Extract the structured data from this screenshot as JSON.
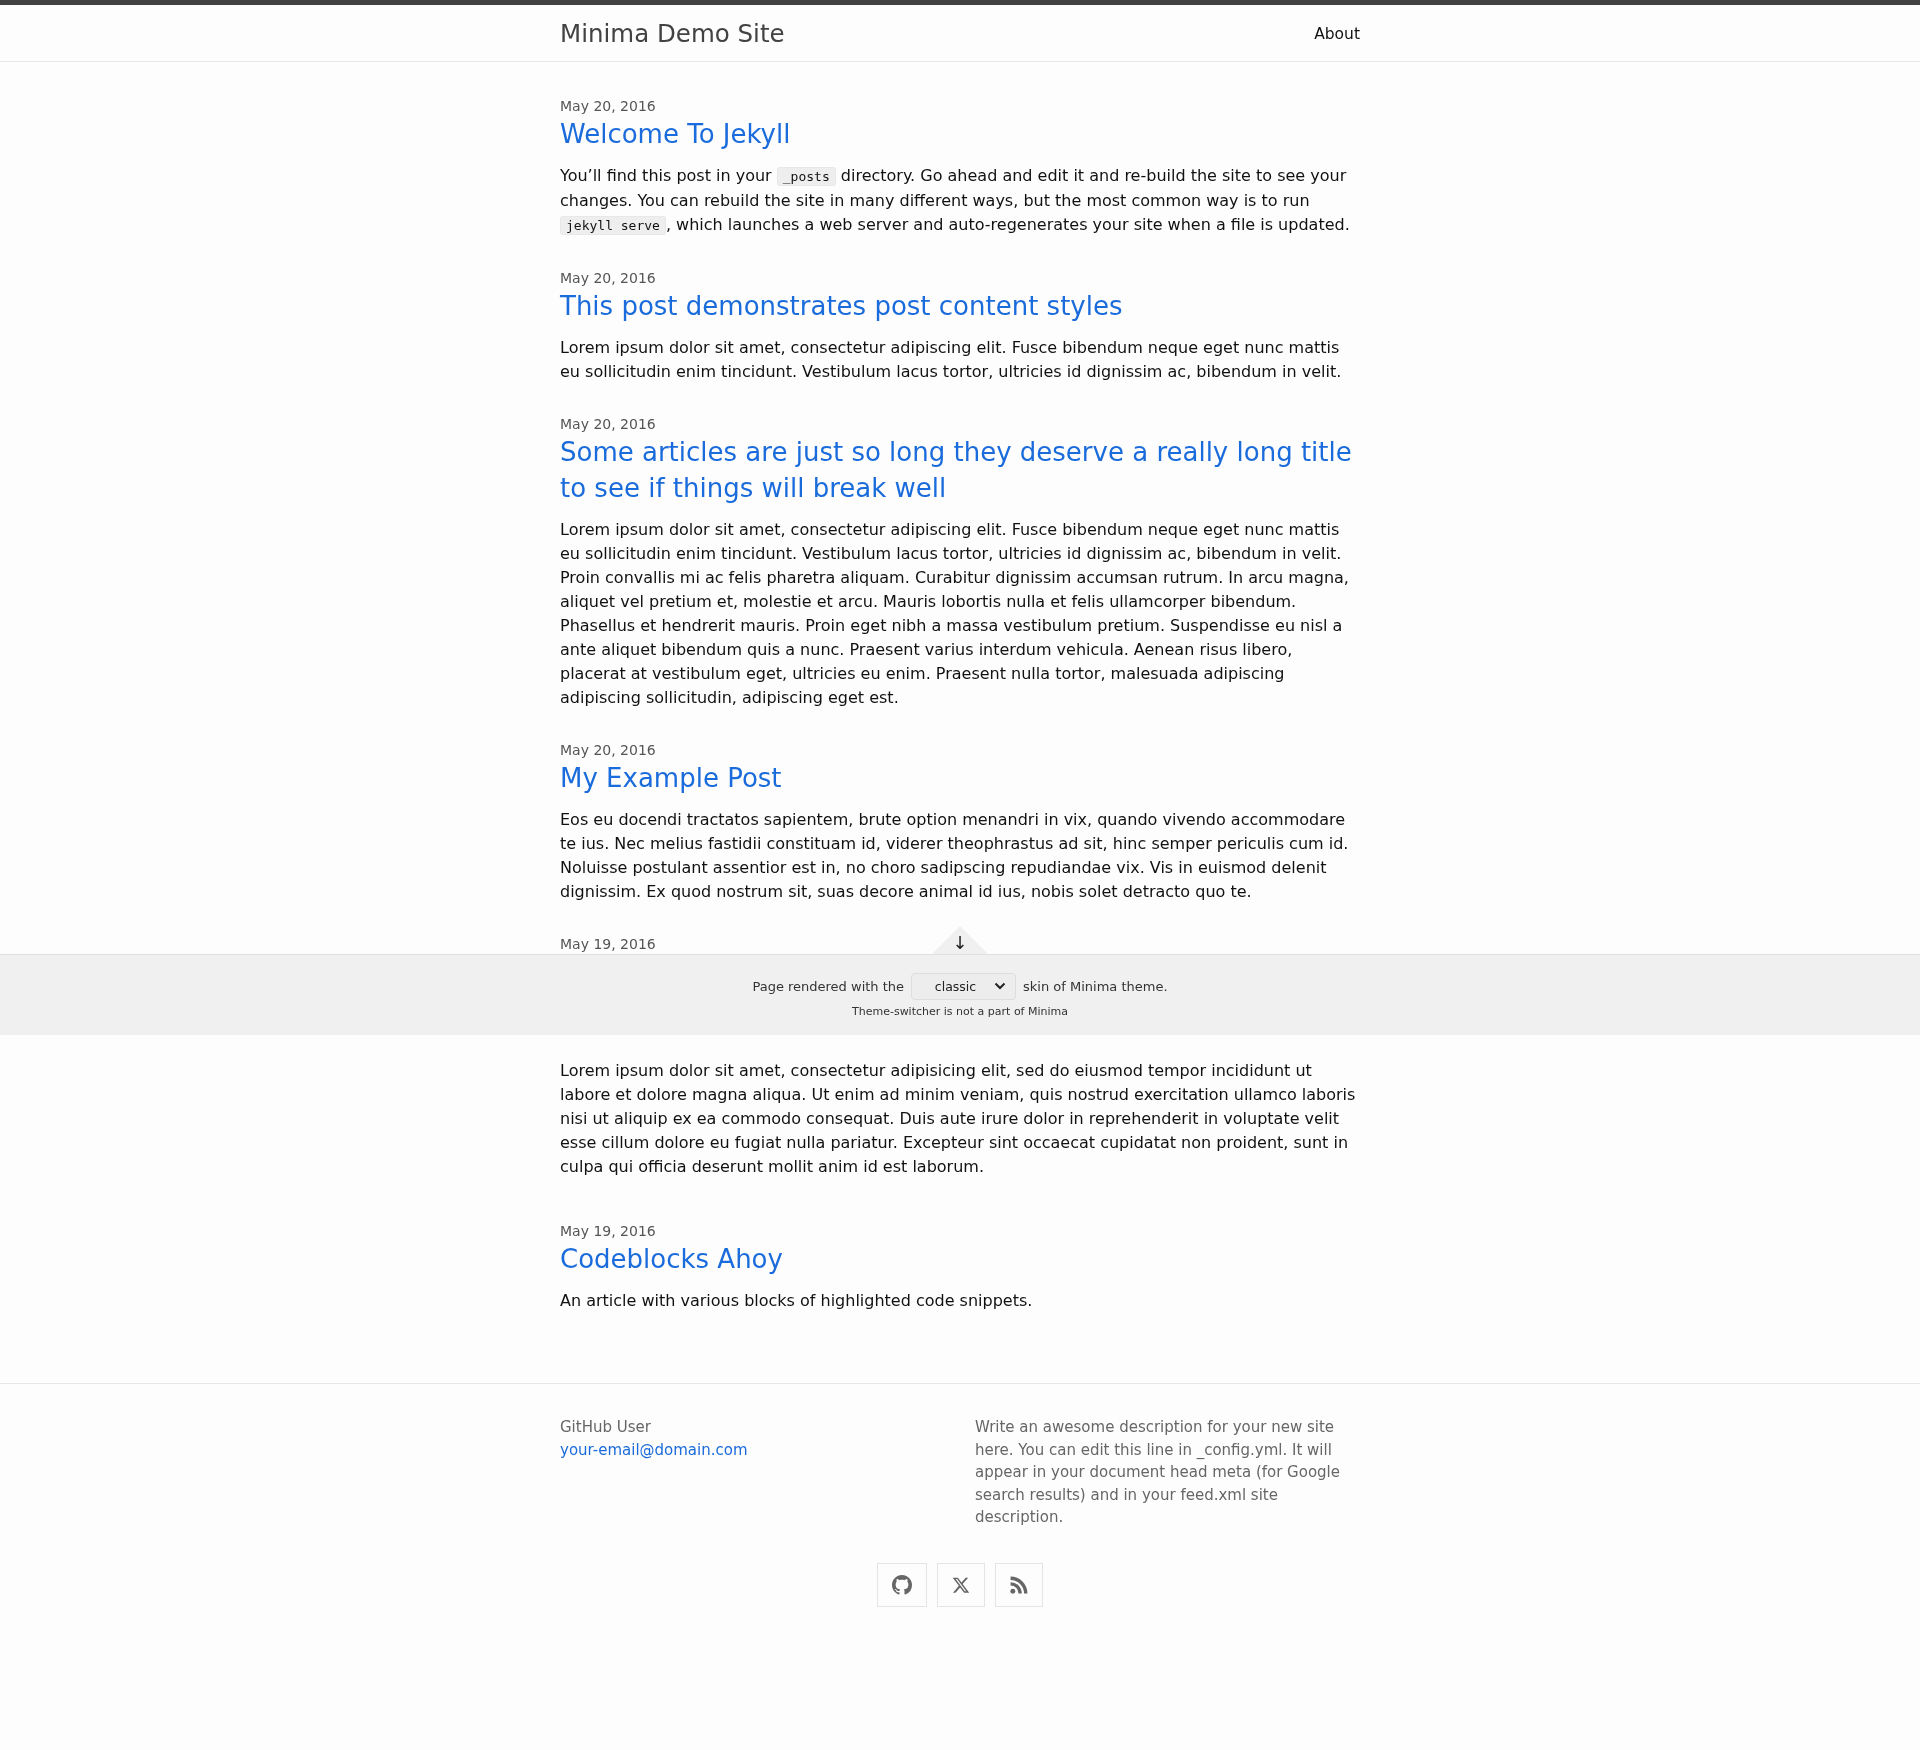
{
  "header": {
    "site_title": "Minima Demo Site",
    "nav": [
      {
        "label": "About"
      }
    ]
  },
  "posts": [
    {
      "date": "May 20, 2016",
      "title": "Welcome To Jekyll",
      "excerpt": [
        {
          "kind": "text",
          "text": "You’ll find this post in your "
        },
        {
          "kind": "code",
          "text": "_posts"
        },
        {
          "kind": "text",
          "text": " directory. Go ahead and edit it and re-build the site to see your changes. You can rebuild the site in many different ways, but the most common way is to run "
        },
        {
          "kind": "code",
          "text": "jekyll serve"
        },
        {
          "kind": "text",
          "text": ", which launches a web server and auto-regenerates your site when a file is updated."
        }
      ]
    },
    {
      "date": "May 20, 2016",
      "title": "This post demonstrates post content styles",
      "excerpt": [
        {
          "kind": "text",
          "text": "Lorem ipsum dolor sit amet, consectetur adipiscing elit. Fusce bibendum neque eget nunc mattis eu sollicitudin enim tincidunt. Vestibulum lacus tortor, ultricies id dignissim ac, bibendum in velit."
        }
      ]
    },
    {
      "date": "May 20, 2016",
      "title": "Some articles are just so long they deserve a really long title to see if things will break well",
      "excerpt": [
        {
          "kind": "text",
          "text": "Lorem ipsum dolor sit amet, consectetur adipiscing elit. Fusce bibendum neque eget nunc mattis eu sollicitudin enim tincidunt. Vestibulum lacus tortor, ultricies id dignissim ac, bibendum in velit. Proin convallis mi ac felis pharetra aliquam. Curabitur dignissim accumsan rutrum. In arcu magna, aliquet vel pretium et, molestie et arcu. Mauris lobortis nulla et felis ullamcorper bibendum. Phasellus et hendrerit mauris. Proin eget nibh a massa vestibulum pretium. Suspendisse eu nisl a ante aliquet bibendum quis a nunc. Praesent varius interdum vehicula. Aenean risus libero, placerat at vestibulum eget, ultricies eu enim. Praesent nulla tortor, malesuada adipiscing adipiscing sollicitudin, adipiscing eget est."
        }
      ]
    },
    {
      "date": "May 20, 2016",
      "title": "My Example Post",
      "excerpt": [
        {
          "kind": "text",
          "text": "Eos eu docendi tractatos sapientem, brute option menandri in vix, quando vivendo accommodare te ius. Nec melius fastidii constituam id, viderer theophrastus ad sit, hinc semper periculis cum id. Noluisse postulant assentior est in, no choro sadipscing repudiandae vix. Vis in euismod delenit dignissim. Ex quod nostrum sit, suas decore animal id ius, nobis solet detracto quo te."
        }
      ]
    }
  ],
  "covered_post": {
    "date": "May 19, 2016",
    "excerpt": [
      {
        "kind": "text",
        "text": "Lorem ipsum dolor sit amet, consectetur adipisicing elit, sed do eiusmod tempor incididunt ut labore et dolore magna aliqua. Ut enim ad minim veniam, quis nostrud exercitation ullamco laboris nisi ut aliquip ex ea commodo consequat. Duis aute irure dolor in reprehenderit in voluptate velit esse cillum dolore eu fugiat nulla pariatur. Excepteur sint occaecat cupidatat non proident, sunt in culpa qui officia deserunt mollit anim id est laborum."
      }
    ]
  },
  "theme_switcher": {
    "toggle": "↓",
    "text_before": "Page rendered with the",
    "skin": "classic",
    "text_after": "skin of Minima theme.",
    "note": "Theme-switcher is not a part of Minima"
  },
  "more_posts": [
    {
      "date": "May 19, 2016",
      "title": "Codeblocks Ahoy",
      "excerpt": [
        {
          "kind": "text",
          "text": "An article with various blocks of highlighted code snippets."
        }
      ]
    }
  ],
  "footer": {
    "author": "GitHub User",
    "email": "your-email@domain.com",
    "description": "Write an awesome description for your new site here. You can edit this line in _config.yml. It will appear in your document head meta (for Google search results) and in your feed.xml site description.",
    "social": [
      {
        "kind": "github"
      },
      {
        "kind": "x"
      },
      {
        "kind": "rss"
      }
    ]
  }
}
